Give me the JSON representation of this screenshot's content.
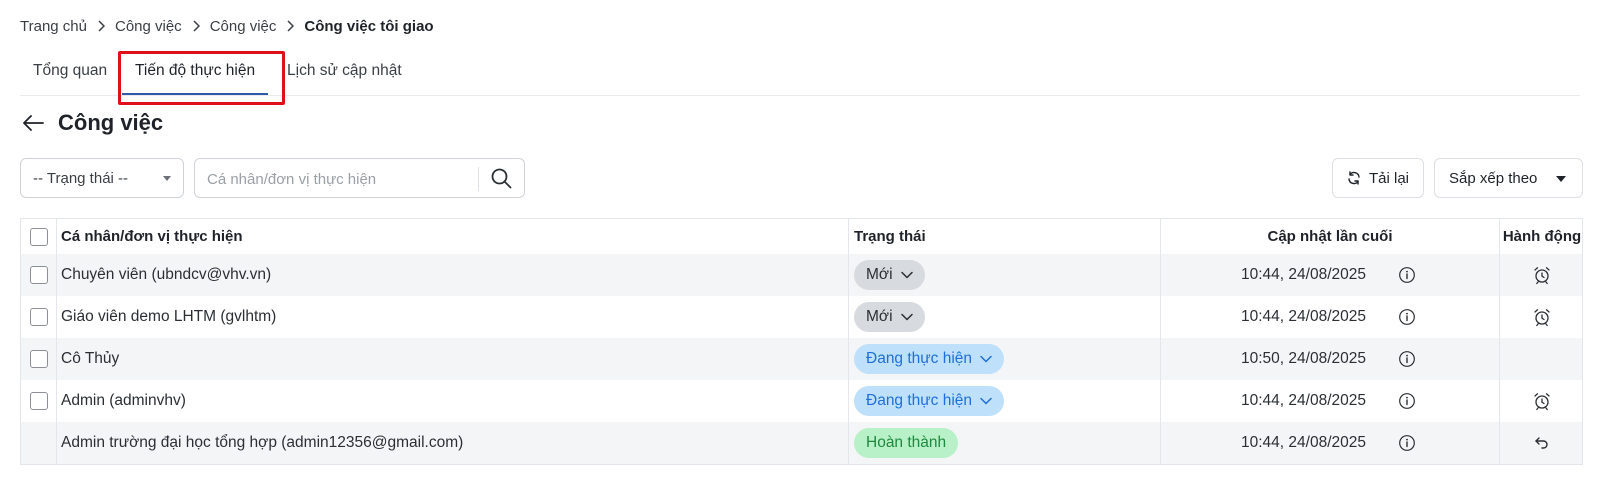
{
  "breadcrumb": {
    "items": [
      "Trang chủ",
      "Công việc",
      "Công việc"
    ],
    "current": "Công việc tôi giao"
  },
  "tabs": [
    {
      "label": "Tổng quan",
      "active": false
    },
    {
      "label": "Tiến độ thực hiện",
      "active": true
    },
    {
      "label": "Lịch sử cập nhật",
      "active": false
    }
  ],
  "page": {
    "title": "Công việc"
  },
  "filters": {
    "status_select": "-- Trạng thái --",
    "search_placeholder": "Cá nhân/đơn vị thực hiện",
    "reload_label": "Tải lại",
    "sort_label": "Sắp xếp theo"
  },
  "table": {
    "columns": {
      "name": "Cá nhân/đơn vị thực hiện",
      "status": "Trạng thái",
      "updated": "Cập nhật lần cuối",
      "action": "Hành động"
    },
    "rows": [
      {
        "name": "Chuyên viên (ubndcv@vhv.vn)",
        "status": "Mới",
        "status_type": "new",
        "updated": "10:44, 24/08/2025",
        "action_icon": "alarm-clock-icon",
        "has_checkbox": true
      },
      {
        "name": "Giáo viên demo LHTM (gvlhtm)",
        "status": "Mới",
        "status_type": "new",
        "updated": "10:44, 24/08/2025",
        "action_icon": "alarm-clock-icon",
        "has_checkbox": true
      },
      {
        "name": "Cô Thủy",
        "status": "Đang thực hiện",
        "status_type": "progress",
        "updated": "10:50, 24/08/2025",
        "action_icon": "",
        "has_checkbox": true
      },
      {
        "name": "Admin (adminvhv)",
        "status": "Đang thực hiện",
        "status_type": "progress",
        "updated": "10:44, 24/08/2025",
        "action_icon": "alarm-clock-icon",
        "has_checkbox": true
      },
      {
        "name": "Admin trường đại học tổng hợp (admin12356@gmail.com)",
        "status": "Hoàn thành",
        "status_type": "done",
        "updated": "10:44, 24/08/2025",
        "action_icon": "undo-icon",
        "has_checkbox": false
      }
    ]
  },
  "colors": {
    "highlight": "#e0101a",
    "active_tab_underline": "#2e5aa8",
    "pill_new_bg": "#d7dade",
    "pill_progress_bg": "#bfe0fb",
    "pill_progress_text": "#1e6fd9",
    "pill_done_bg": "#b8f0c8",
    "pill_done_text": "#1e8a3e"
  }
}
